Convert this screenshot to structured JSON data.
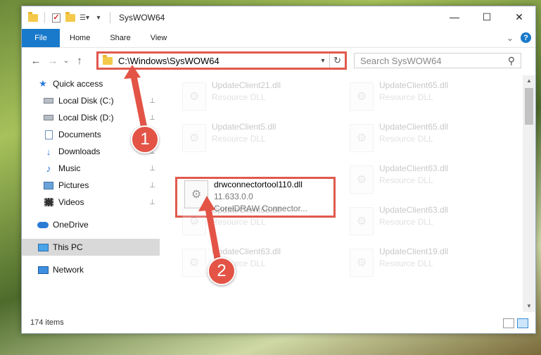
{
  "window": {
    "title": "SysWOW64",
    "minimize": "—",
    "maximize": "☐",
    "close": "✕"
  },
  "ribbon": {
    "tabs": [
      "File",
      "Home",
      "Share",
      "View"
    ],
    "expand": "⌄",
    "help": "?"
  },
  "nav": {
    "back": "←",
    "forward": "→",
    "recent": "⌄",
    "up": "↑",
    "address": "C:\\Windows\\SysWOW64",
    "dropdown": "▾",
    "refresh": "↻",
    "search_placeholder": "Search SysWOW64",
    "search_icon": "⚲"
  },
  "sidebar": {
    "items": [
      {
        "label": "Quick access",
        "icon": "star-icon"
      },
      {
        "label": "Local Disk (C:)",
        "icon": "drive-icon",
        "pinned": true
      },
      {
        "label": "Local Disk (D:)",
        "icon": "drive-icon",
        "pinned": true
      },
      {
        "label": "Documents",
        "icon": "documents-icon",
        "pinned": true
      },
      {
        "label": "Downloads",
        "icon": "downloads-icon",
        "pinned": true
      },
      {
        "label": "Music",
        "icon": "music-icon",
        "pinned": true
      },
      {
        "label": "Pictures",
        "icon": "pictures-icon",
        "pinned": true
      },
      {
        "label": "Videos",
        "icon": "videos-icon",
        "pinned": true
      },
      {
        "label": "OneDrive",
        "icon": "onedrive-icon"
      },
      {
        "label": "This PC",
        "icon": "pc-icon",
        "selected": true
      },
      {
        "label": "Network",
        "icon": "network-icon"
      }
    ],
    "pin_glyph": "📌"
  },
  "files": [
    {
      "name": "UpdateClient21.dll",
      "sub": "Resource DLL",
      "faded": true
    },
    {
      "name": "UpdateClient65.dll",
      "sub": "Resource DLL",
      "faded": true
    },
    {
      "name": "UpdateClient5.dll",
      "sub": "Resource DLL",
      "faded": true
    },
    {
      "name": "UpdateClient65.dll",
      "sub": "Resource DLL",
      "faded": true
    },
    {
      "name": "drwconnectortool110.dll",
      "sub": "11.633.0.0",
      "sub2": "CorelDRAW Connector...",
      "faded": false
    },
    {
      "name": "UpdateClient63.dll",
      "sub": "Resource DLL",
      "faded": true
    },
    {
      "name": "UpdateClient65.dll",
      "sub": "Resource DLL",
      "faded": true
    },
    {
      "name": "UpdateClient63.dll",
      "sub": "Resource DLL",
      "faded": true
    },
    {
      "name": "UpdateClient63.dll",
      "sub": "Resource DLL",
      "faded": true
    },
    {
      "name": "UpdateClient19.dll",
      "sub": "Resource DLL",
      "faded": true
    }
  ],
  "status": {
    "items_count": "174 items"
  },
  "annotations": {
    "marker1": "1",
    "marker2": "2",
    "color": "#e35447"
  },
  "colors": {
    "accent": "#1979ca",
    "highlight_border": "#e05a4e"
  }
}
